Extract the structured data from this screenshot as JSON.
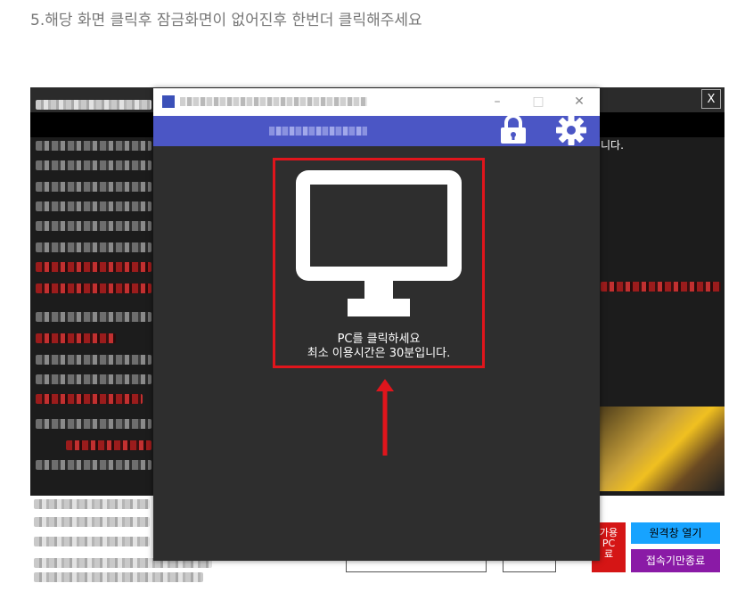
{
  "caption": "5.해당 화면 클릭후 잠금화면이 없어진후 한번더 클릭해주세요",
  "background_screen": {
    "close_label": "X",
    "right_text": "니다.",
    "red_button_label": "가용\nPC\n료",
    "remote_window_button": "원격창 열기",
    "end_connection_button": "접속기만종료"
  },
  "window": {
    "controls": {
      "minimize": "–",
      "maximize": "□",
      "close": "✕"
    },
    "header_icons": [
      "lock-icon",
      "gear-icon"
    ],
    "monitor_icon": "monitor-icon",
    "message_line1": "PC를 클릭하세요",
    "message_line2": "최소 이용시간은 30분입니다."
  },
  "colors": {
    "header_blue": "#4b56c5",
    "window_body": "#2e2e2e",
    "highlight_red": "#e0151c",
    "arrow_red": "#e0151c"
  }
}
